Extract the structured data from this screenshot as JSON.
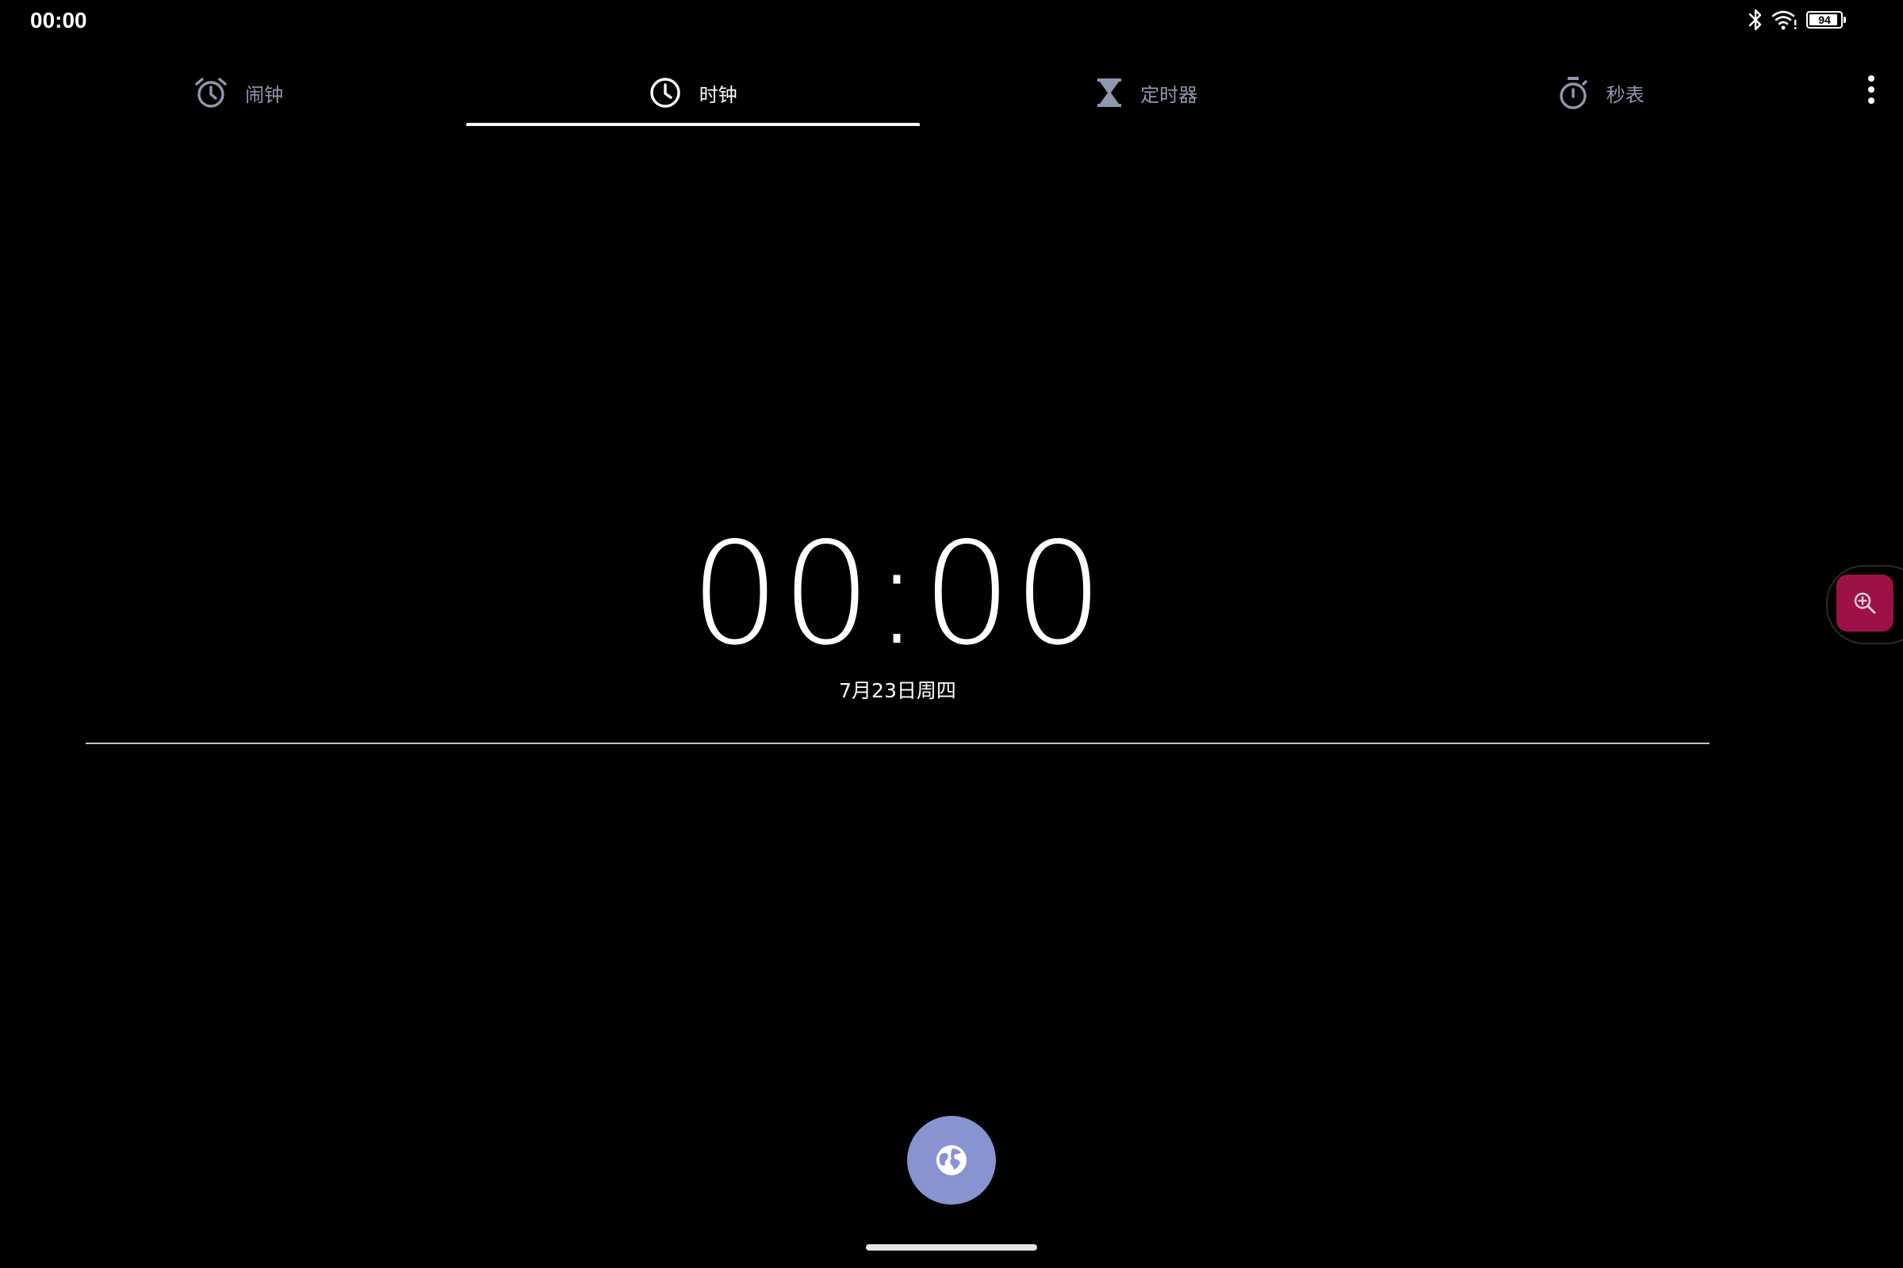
{
  "status_bar": {
    "time": "00:00",
    "battery_level": "94",
    "icons": [
      "bluetooth-icon",
      "wifi-icon",
      "battery-icon"
    ]
  },
  "tabs": [
    {
      "label": "闹钟",
      "icon": "alarm-clock-icon",
      "active": false
    },
    {
      "label": "时钟",
      "icon": "clock-icon",
      "active": true
    },
    {
      "label": "定时器",
      "icon": "hourglass-icon",
      "active": false
    },
    {
      "label": "秒表",
      "icon": "stopwatch-icon",
      "active": false
    }
  ],
  "overflow_menu_icon": "more-vertical-icon",
  "clock": {
    "time": "00:00",
    "date": "7月23日周四"
  },
  "fab": {
    "icon": "globe-icon"
  },
  "side_button": {
    "icon": "zoom-in-icon"
  },
  "colors": {
    "background": "#000000",
    "tab_inactive": "#8f98ad",
    "tab_active": "#ffffff",
    "fab": "#8893cf",
    "zoom_button": "#9c1146"
  }
}
